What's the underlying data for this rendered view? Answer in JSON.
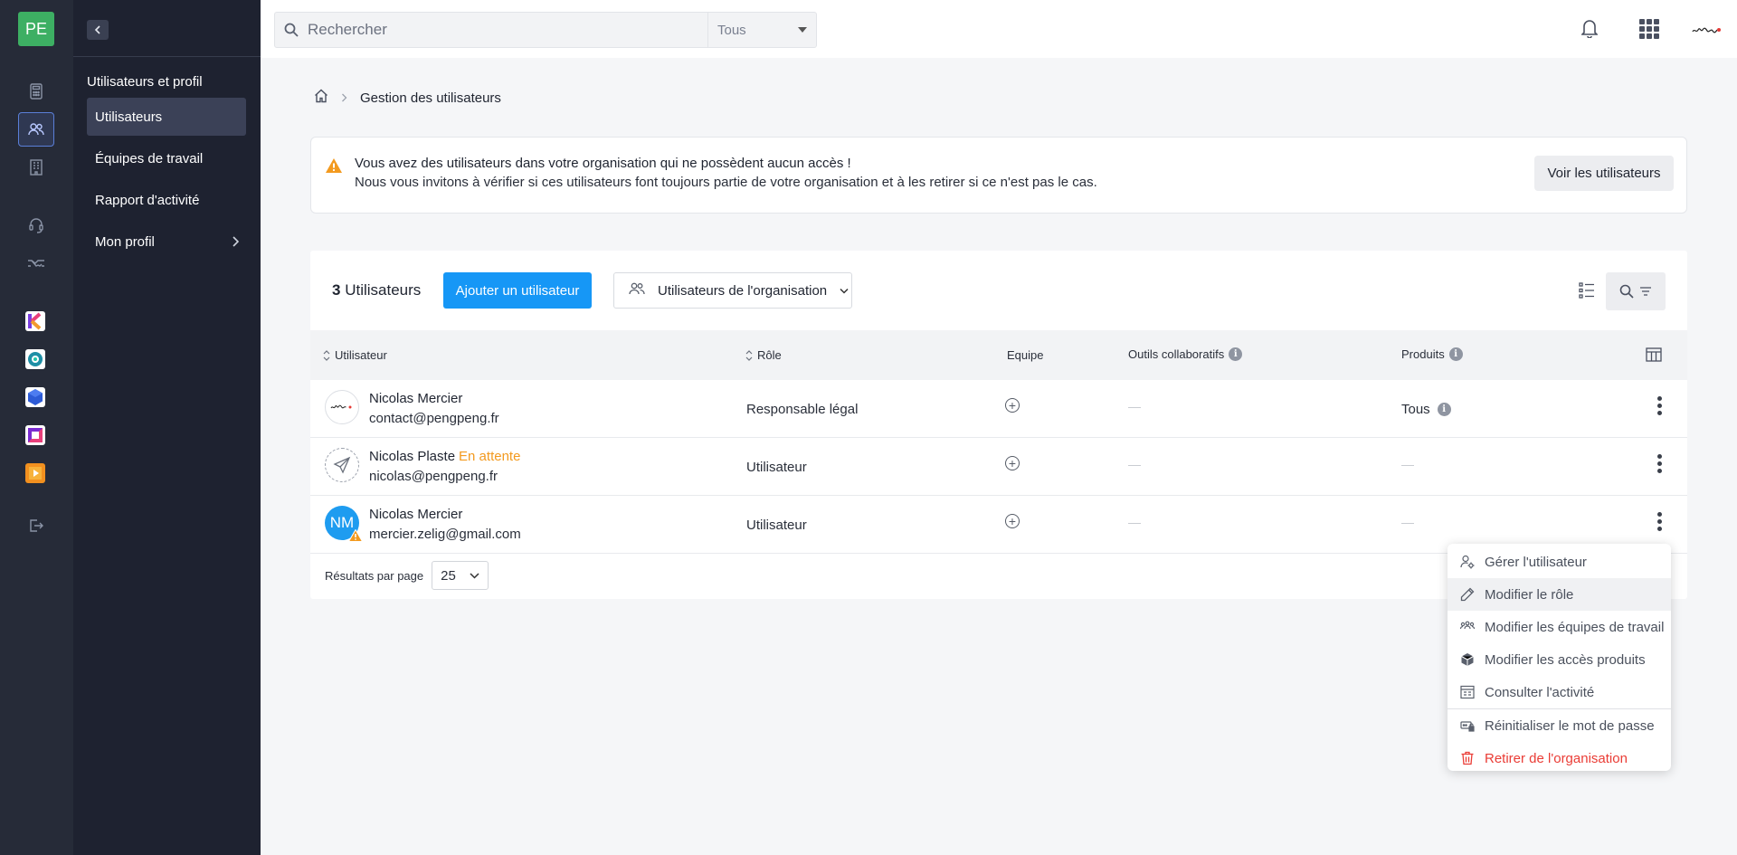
{
  "rail": {
    "logo": "PE",
    "apps": [
      {
        "name": "app-k",
        "color": "#e9407b"
      },
      {
        "name": "app-teal",
        "color": "#1e8fa6"
      },
      {
        "name": "app-blue",
        "color": "#2d5bd6"
      },
      {
        "name": "app-purple",
        "color": "#7a2bd1"
      },
      {
        "name": "app-orange",
        "color": "#f2901f"
      }
    ]
  },
  "sidebar": {
    "section_title": "Utilisateurs et profil",
    "items": [
      {
        "label": "Utilisateurs"
      },
      {
        "label": "Équipes de travail"
      },
      {
        "label": "Rapport d'activité"
      },
      {
        "label": "Mon profil"
      }
    ]
  },
  "topbar": {
    "search_placeholder": "Rechercher",
    "search_scope": "Tous",
    "brand": "Pengpeng"
  },
  "breadcrumb": {
    "current": "Gestion des utilisateurs"
  },
  "alert": {
    "line1": "Vous avez des utilisateurs dans votre organisation qui ne possèdent aucun accès !",
    "line2": "Nous vous invitons à vérifier si ces utilisateurs font toujours partie de votre organisation et à les retirer si ce n'est pas le cas.",
    "button": "Voir les utilisateurs"
  },
  "users_card": {
    "count": "3",
    "count_label": "Utilisateurs",
    "add_button": "Ajouter un utilisateur",
    "org_filter": "Utilisateurs de l'organisation",
    "columns": {
      "user": "Utilisateur",
      "role": "Rôle",
      "team": "Equipe",
      "tools": "Outils collaboratifs",
      "products": "Produits"
    },
    "rows": [
      {
        "name": "Nicolas Mercier",
        "status": "",
        "email": "contact@pengpeng.fr",
        "role": "Responsable légal",
        "products": "Tous"
      },
      {
        "name": "Nicolas Plaste",
        "status": "En attente",
        "email": "nicolas@pengpeng.fr",
        "role": "Utilisateur",
        "products": ""
      },
      {
        "name": "Nicolas Mercier",
        "status": "",
        "email": "mercier.zelig@gmail.com",
        "role": "Utilisateur",
        "products": "",
        "initials": "NM"
      }
    ],
    "pager_label": "Résultats par page",
    "pager_value": "25"
  },
  "context_menu": {
    "items": [
      {
        "label": "Gérer l'utilisateur",
        "icon": "user-gear-icon"
      },
      {
        "label": "Modifier le rôle",
        "icon": "pencil-icon"
      },
      {
        "label": "Modifier les équipes de travail",
        "icon": "team-icon"
      },
      {
        "label": "Modifier les accès produits",
        "icon": "box-icon"
      },
      {
        "label": "Consulter l'activité",
        "icon": "activity-icon"
      },
      {
        "label": "Réinitialiser le mot de passe",
        "icon": "password-icon"
      },
      {
        "label": "Retirer de l'organisation",
        "icon": "trash-icon"
      }
    ]
  },
  "colors": {
    "accent": "#1697f6",
    "warning": "#f39a1f",
    "danger": "#ea3c35",
    "logo": "#3daf63"
  }
}
